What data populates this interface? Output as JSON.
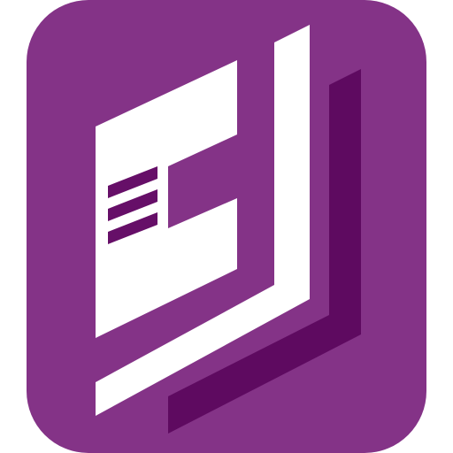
{
  "icon": {
    "name": "document-app-logo",
    "colors": {
      "background": "#ffffff",
      "tile": "#843387",
      "shadow": "#5e0a60",
      "foreground": "#ffffff",
      "stripes": "#660f68"
    }
  }
}
